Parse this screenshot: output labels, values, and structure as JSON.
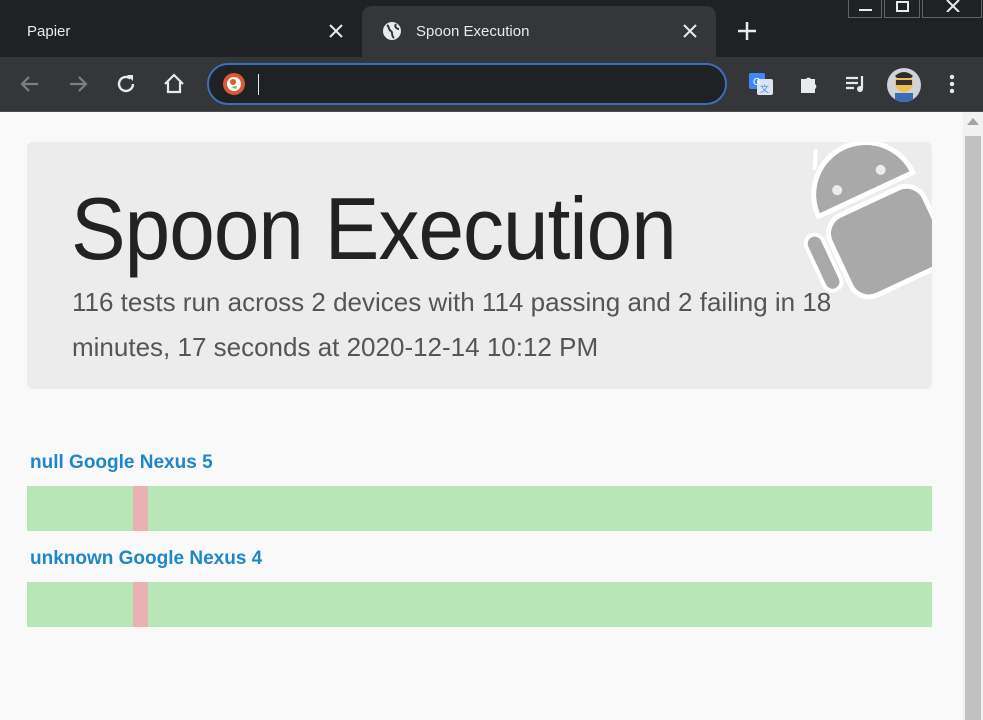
{
  "browser": {
    "tabs": [
      {
        "title": "Papier",
        "active": false
      },
      {
        "title": "Spoon Execution",
        "active": true
      }
    ],
    "address_value": "",
    "colors": {
      "frame": "#202124",
      "toolbar": "#35363a",
      "accent": "#3b6fb6"
    }
  },
  "page": {
    "title": "Spoon Execution",
    "summary": "116 tests run across 2 devices with 114 passing and 2 failing in 18 minutes, 17 seconds at 2020-12-14 10:12 PM",
    "devices": [
      {
        "name": "null Google Nexus 5",
        "failure_position_fraction": 0.117
      },
      {
        "name": "unknown Google Nexus 4",
        "failure_position_fraction": 0.117
      }
    ],
    "colors": {
      "pass": "#b9e6b7",
      "fail": "#e9b1b1",
      "device_link": "#1f86c9"
    }
  }
}
